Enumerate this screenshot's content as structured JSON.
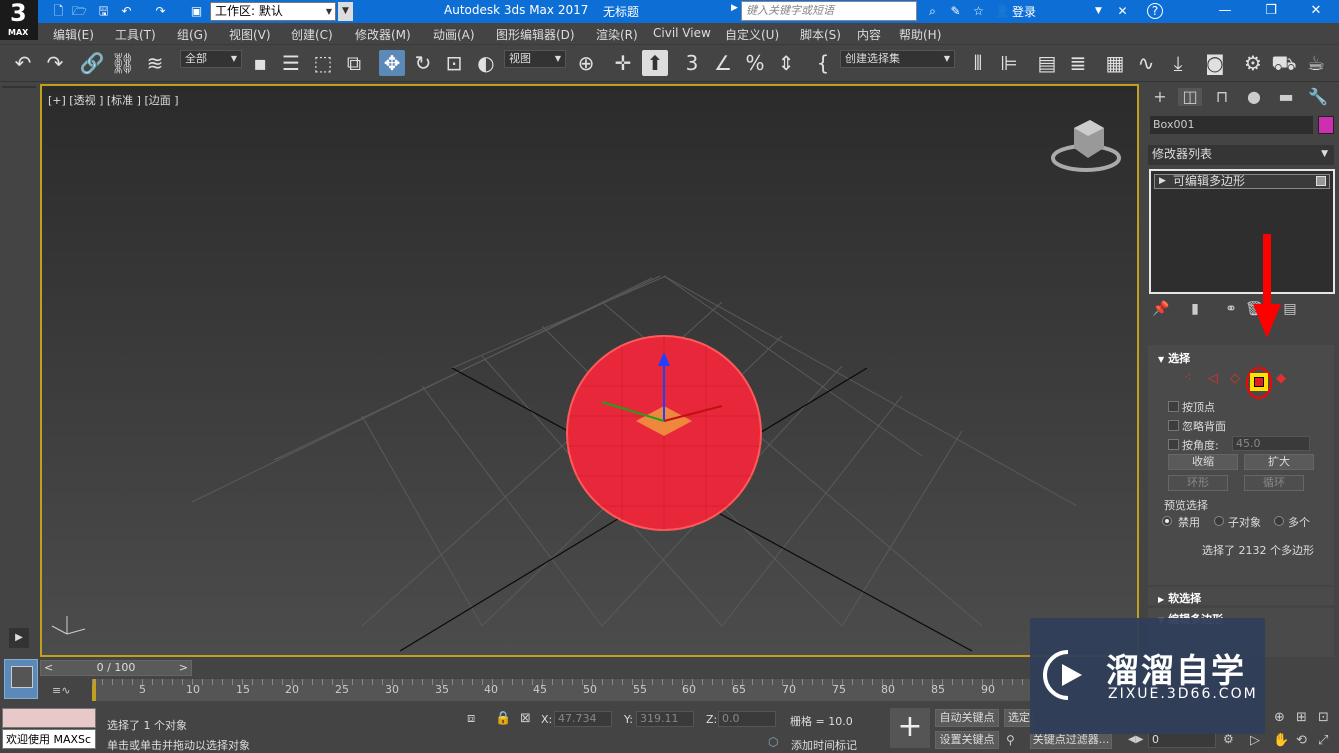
{
  "title_bar": {
    "logo_number": "3",
    "logo_text": "MAX",
    "workspace_label": "工作区: 默认",
    "app_title": "Autodesk 3ds Max 2017",
    "doc_title": "无标题",
    "search_placeholder": "键入关键字或短语",
    "login_label": "登录",
    "help_glyph": "?"
  },
  "menu": {
    "items": [
      "编辑(E)",
      "工具(T)",
      "组(G)",
      "视图(V)",
      "创建(C)",
      "修改器(M)",
      "动画(A)",
      "图形编辑器(D)",
      "渲染(R)",
      "Civil View",
      "自定义(U)",
      "脚本(S)",
      "内容",
      "帮助(H)"
    ]
  },
  "toolbar": {
    "filter_dropdown": "全部",
    "coord_dropdown": "视图",
    "selection_set_dropdown": "创建选择集"
  },
  "viewport": {
    "label": "[+] [透视 ] [标准 ] [边面 ]"
  },
  "command_panel": {
    "object_name": "Box001",
    "object_color": "#cc2fb0",
    "modifier_list_label": "修改器列表",
    "stack_item": "可编辑多边形",
    "selection_rollout": {
      "title": "选择",
      "by_vertex": "按顶点",
      "ignore_backfacing": "忽略背面",
      "by_angle": "按角度:",
      "angle_value": "45.0",
      "shrink": "收缩",
      "grow": "扩大",
      "ring": "环形",
      "loop": "循环",
      "preview_title": "预览选择",
      "preview_off": "禁用",
      "preview_subobject": "子对象",
      "preview_multi": "多个",
      "selection_info": "选择了 2132 个多边形"
    },
    "soft_selection_title": "软选择",
    "edit_poly_title": "编辑多边形"
  },
  "timeline": {
    "frame_counter": "0 / 100",
    "prev_glyph": "<",
    "next_glyph": ">",
    "ticks": [
      "5",
      "10",
      "15",
      "20",
      "25",
      "30",
      "35",
      "40",
      "45",
      "50",
      "55",
      "60",
      "65",
      "70",
      "75",
      "80",
      "85",
      "90"
    ]
  },
  "status": {
    "welcome": "欢迎使用 MAXSc",
    "selected_text": "选择了 1 个对象",
    "prompt_text": "单击或单击并拖动以选择对象",
    "x_label": "X:",
    "x_value": "47.734",
    "y_label": "Y:",
    "y_value": "319.11",
    "z_label": "Z:",
    "z_value": "0.0",
    "grid_text": "栅格 = 10.0",
    "auto_key": "自动关键点",
    "set_key": "设置关键点",
    "selected_obj": "选定",
    "key_filter": "关键点过滤器...",
    "add_time_tag": "添加时间标记",
    "frame_value": "0"
  },
  "watermark": {
    "cn_text": "溜溜自学",
    "url_text": "ZIXUE.3D66.COM"
  }
}
